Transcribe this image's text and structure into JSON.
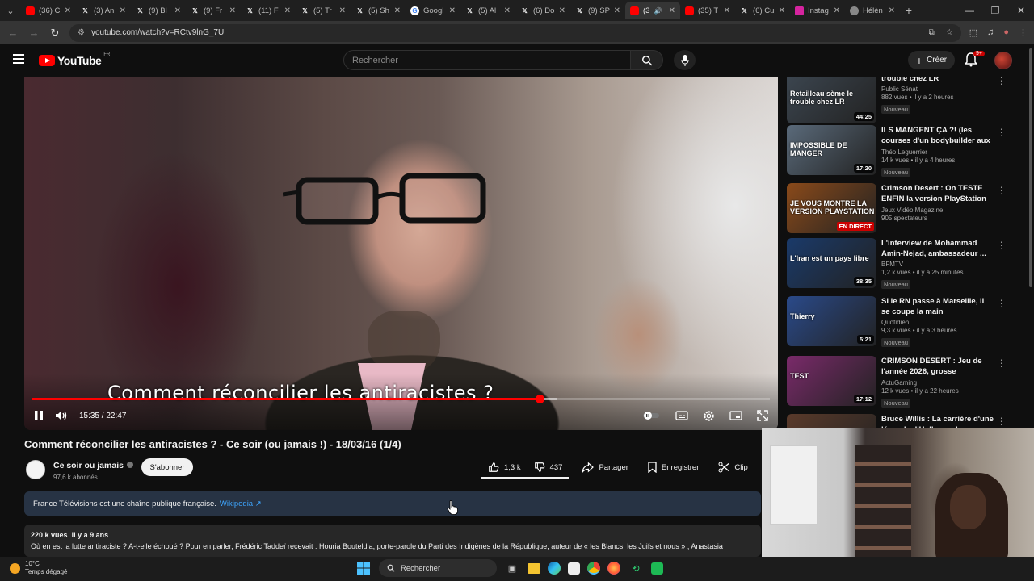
{
  "browser": {
    "tabs": [
      {
        "title": "(36) C",
        "icon": "youtube-icon",
        "color": "#ff0000"
      },
      {
        "title": "(3) An",
        "icon": "x-icon",
        "color": "#000000"
      },
      {
        "title": "(9) Bl",
        "icon": "x-icon",
        "color": "#000000"
      },
      {
        "title": "(9) Fr",
        "icon": "x-icon",
        "color": "#000000"
      },
      {
        "title": "(11) F",
        "icon": "x-icon",
        "color": "#000000"
      },
      {
        "title": "(5) Tr",
        "icon": "x-icon",
        "color": "#000000"
      },
      {
        "title": "(5) Sh",
        "icon": "x-icon",
        "color": "#000000"
      },
      {
        "title": "Googl",
        "icon": "google-icon",
        "color": "#4285f4"
      },
      {
        "title": "(5) Al",
        "icon": "x-icon",
        "color": "#000000"
      },
      {
        "title": "(6) Do",
        "icon": "x-icon",
        "color": "#000000"
      },
      {
        "title": "(9) SP",
        "icon": "x-icon",
        "color": "#000000"
      },
      {
        "title": "(3",
        "icon": "youtube-icon",
        "color": "#ff0000",
        "active": true
      },
      {
        "title": "(35) T",
        "icon": "youtube-icon",
        "color": "#ff0000"
      },
      {
        "title": "(6) Cu",
        "icon": "x-icon",
        "color": "#000000"
      },
      {
        "title": "Instag",
        "icon": "instagram-icon",
        "color": "#d6249f"
      },
      {
        "title": "Hélèn",
        "icon": "globe-icon",
        "color": "#888888"
      }
    ],
    "url": "youtube.com/watch?v=RCtv9lnG_7U"
  },
  "header": {
    "logo_text": "YouTube",
    "country_code": "FR",
    "search_placeholder": "Rechercher",
    "create_label": "Créer",
    "notif_count": "9+"
  },
  "player": {
    "subtitle": "Comment réconcilier les antiracistes ?",
    "time_current": "15:35",
    "time_total": "22:47",
    "progress": 0.688,
    "buffered": 0.712
  },
  "video": {
    "title": "Comment réconcilier les antiracistes ? - Ce soir (ou jamais !) - 18/03/16 (1/4)",
    "channel": "Ce soir ou jamais",
    "subscribers": "97,6 k abonnés",
    "subscribe_label": "S'abonner",
    "likes": "1,3 k",
    "dislikes": "437",
    "share_label": "Partager",
    "save_label": "Enregistrer",
    "clip_label": "Clip",
    "info_text": "France Télévisions est une chaîne publique française.",
    "info_link": "Wikipedia",
    "views": "220 k vues",
    "age": "il y a 9 ans",
    "description": "Où en est la lutte antiraciste ? A-t-elle échoué ? Pour en parler, Frédéric Taddeï recevait : Houria Bouteldja, porte-parole du Parti des Indigènes de la République, auteur de « les Blancs, les Juifs et nous » ; Anastasia"
  },
  "recommendations": [
    {
      "title": "trouble chez LR",
      "channel": "Public Sénat",
      "stats": "882 vues • il y a 2 heures",
      "badge": "Nouveau",
      "duration": "44:25",
      "overlay": "Retailleau sème le trouble chez LR",
      "bg": "#3c4650"
    },
    {
      "title": "ILS MANGENT ÇA ?! (les courses d'un bodybuilder aux ...",
      "channel": "Théo Leguerrier",
      "stats": "14 k vues • il y a 4 heures",
      "badge": "Nouveau",
      "duration": "17:20",
      "overlay": "IMPOSSIBLE DE MANGER",
      "bg": "#5a6a7a"
    },
    {
      "title": "Crimson Desert : On TESTE ENFIN la version PlayStation 5...",
      "channel": "Jeux Vidéo Magazine",
      "stats": "905 spectateurs",
      "badge": "",
      "duration": "EN DIRECT",
      "overlay": "JE VOUS MONTRE LA VERSION PLAYSTATION",
      "bg": "#8a4a1a"
    },
    {
      "title": "L'interview de Mohammad Amin-Nejad, ambassadeur ...",
      "channel": "BFMTV",
      "stats": "1,2 k vues • il y a 25 minutes",
      "badge": "Nouveau",
      "duration": "38:35",
      "overlay": "L'Iran est un pays libre",
      "bg": "#1a3a6a"
    },
    {
      "title": "Si le RN passe à Marseille, il se coupe la main",
      "channel": "Quotidien",
      "stats": "9,3 k vues • il y a 3 heures",
      "badge": "Nouveau",
      "duration": "5:21",
      "overlay": "Thierry",
      "bg": "#2a4a8a"
    },
    {
      "title": "CRIMSON DESERT : Jeu de l'année 2026, grosse déceptio...",
      "channel": "ActuGaming",
      "stats": "12 k vues • il y a 22 heures",
      "badge": "Nouveau",
      "duration": "17:12",
      "overlay": "TEST",
      "bg": "#7a2a6a"
    },
    {
      "title": "Bruce Willis : La carrière d'une légende d'Hollywood",
      "channel": "",
      "stats": "",
      "badge": "",
      "duration": "",
      "overlay": "",
      "bg": "#5a3a2a"
    }
  ],
  "taskbar": {
    "temperature": "10°C",
    "weather": "Temps dégagé",
    "search_label": "Rechercher"
  },
  "colors": {
    "brand_red": "#ff0000",
    "link_blue": "#3ea6ff",
    "info_bg": "#273344"
  }
}
